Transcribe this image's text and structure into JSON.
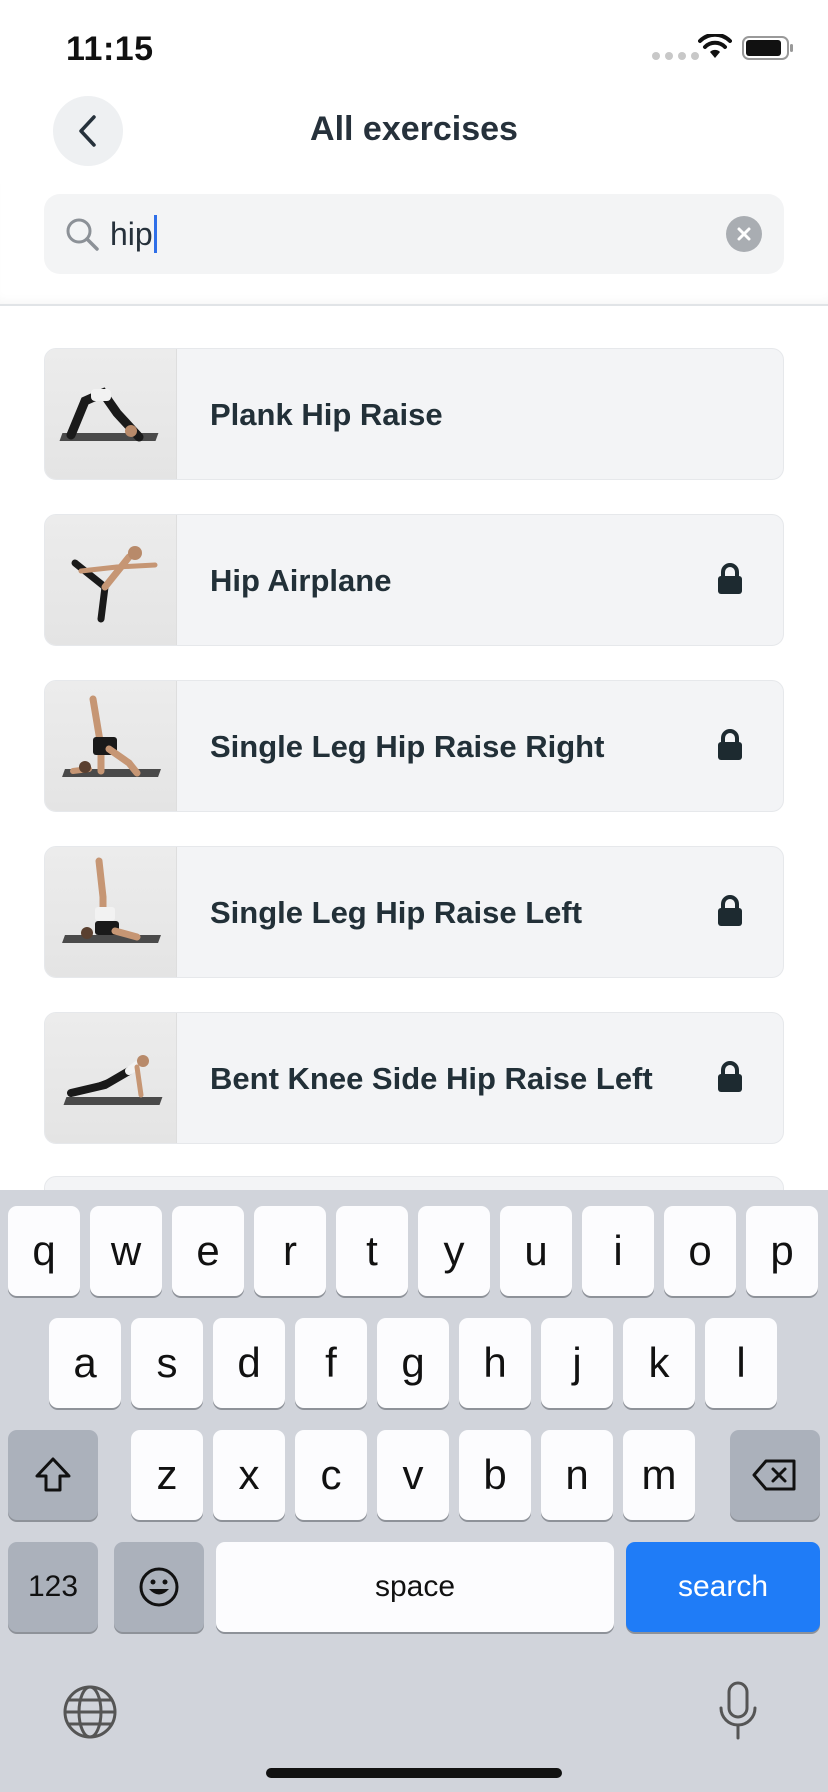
{
  "status_bar": {
    "time": "11:15"
  },
  "header": {
    "title": "All exercises"
  },
  "search": {
    "value": "hip"
  },
  "exercises": [
    {
      "name": "Plank Hip Raise",
      "locked": false,
      "thumb_icon": "person-plank-photo"
    },
    {
      "name": "Hip Airplane",
      "locked": true,
      "thumb_icon": "person-standing-photo"
    },
    {
      "name": "Single Leg Hip Raise Right",
      "locked": true,
      "thumb_icon": "person-hip-raise-photo"
    },
    {
      "name": "Single Leg Hip Raise Left",
      "locked": true,
      "thumb_icon": "person-hip-raise-photo"
    },
    {
      "name": "Bent Knee Side Hip Raise Left",
      "locked": true,
      "thumb_icon": "person-side-plank-photo"
    }
  ],
  "keyboard": {
    "row1": [
      "q",
      "w",
      "e",
      "r",
      "t",
      "y",
      "u",
      "i",
      "o",
      "p"
    ],
    "row2": [
      "a",
      "s",
      "d",
      "f",
      "g",
      "h",
      "j",
      "k",
      "l"
    ],
    "row3": [
      "z",
      "x",
      "c",
      "v",
      "b",
      "n",
      "m"
    ],
    "numbers_label": "123",
    "space_label": "space",
    "search_label": "search"
  },
  "colors": {
    "accent": "#1f7cf7",
    "caret": "#2f6fe8",
    "keyboard_bg": "#d1d4db"
  }
}
